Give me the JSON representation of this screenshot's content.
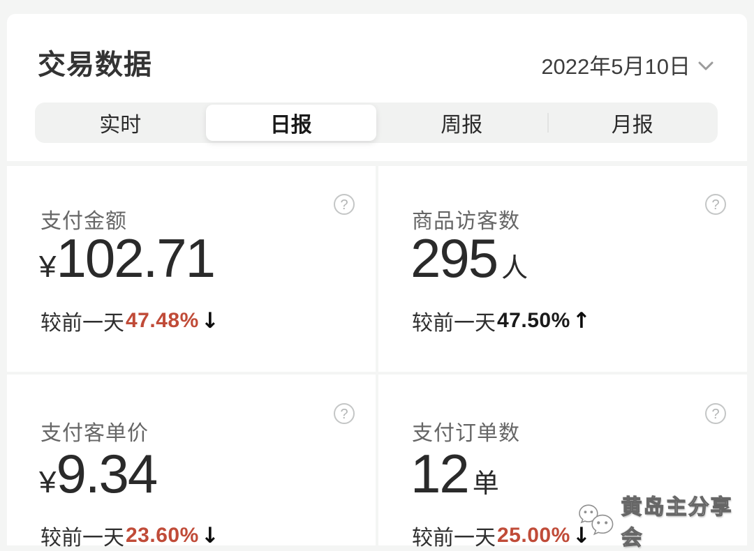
{
  "header": {
    "title": "交易数据",
    "date": "2022年5月10日",
    "tabs": [
      {
        "label": "实时",
        "active": false
      },
      {
        "label": "日报",
        "active": true
      },
      {
        "label": "周报",
        "active": false
      },
      {
        "label": "月报",
        "active": false
      }
    ]
  },
  "icons": {
    "help": "?"
  },
  "metrics": [
    {
      "label": "支付金额",
      "currency": "¥",
      "value": "102.71",
      "unit": "",
      "compare_prefix": "较前一天",
      "change": "47.48%",
      "direction": "down",
      "arrow": "↓",
      "change_color": "#c04b38"
    },
    {
      "label": "商品访客数",
      "currency": "",
      "value": "295",
      "unit": "人",
      "compare_prefix": "较前一天",
      "change": "47.50%",
      "direction": "up",
      "arrow": "↑",
      "change_color": "#1a1a1a"
    },
    {
      "label": "支付客单价",
      "currency": "¥",
      "value": "9.34",
      "unit": "",
      "compare_prefix": "较前一天",
      "change": "23.60%",
      "direction": "down",
      "arrow": "↓",
      "change_color": "#c04b38"
    },
    {
      "label": "支付订单数",
      "currency": "",
      "value": "12",
      "unit": "单",
      "compare_prefix": "较前一天",
      "change": "25.00%",
      "direction": "down",
      "arrow": "↓",
      "change_color": "#c04b38"
    }
  ],
  "watermark": {
    "text": "黄岛主分享会"
  },
  "colors": {
    "page_bg": "#f4f5f4",
    "card_bg": "#ffffff",
    "accent_red": "#c04b38",
    "text_dark": "#2a2a2a",
    "label_grey": "#666666"
  }
}
